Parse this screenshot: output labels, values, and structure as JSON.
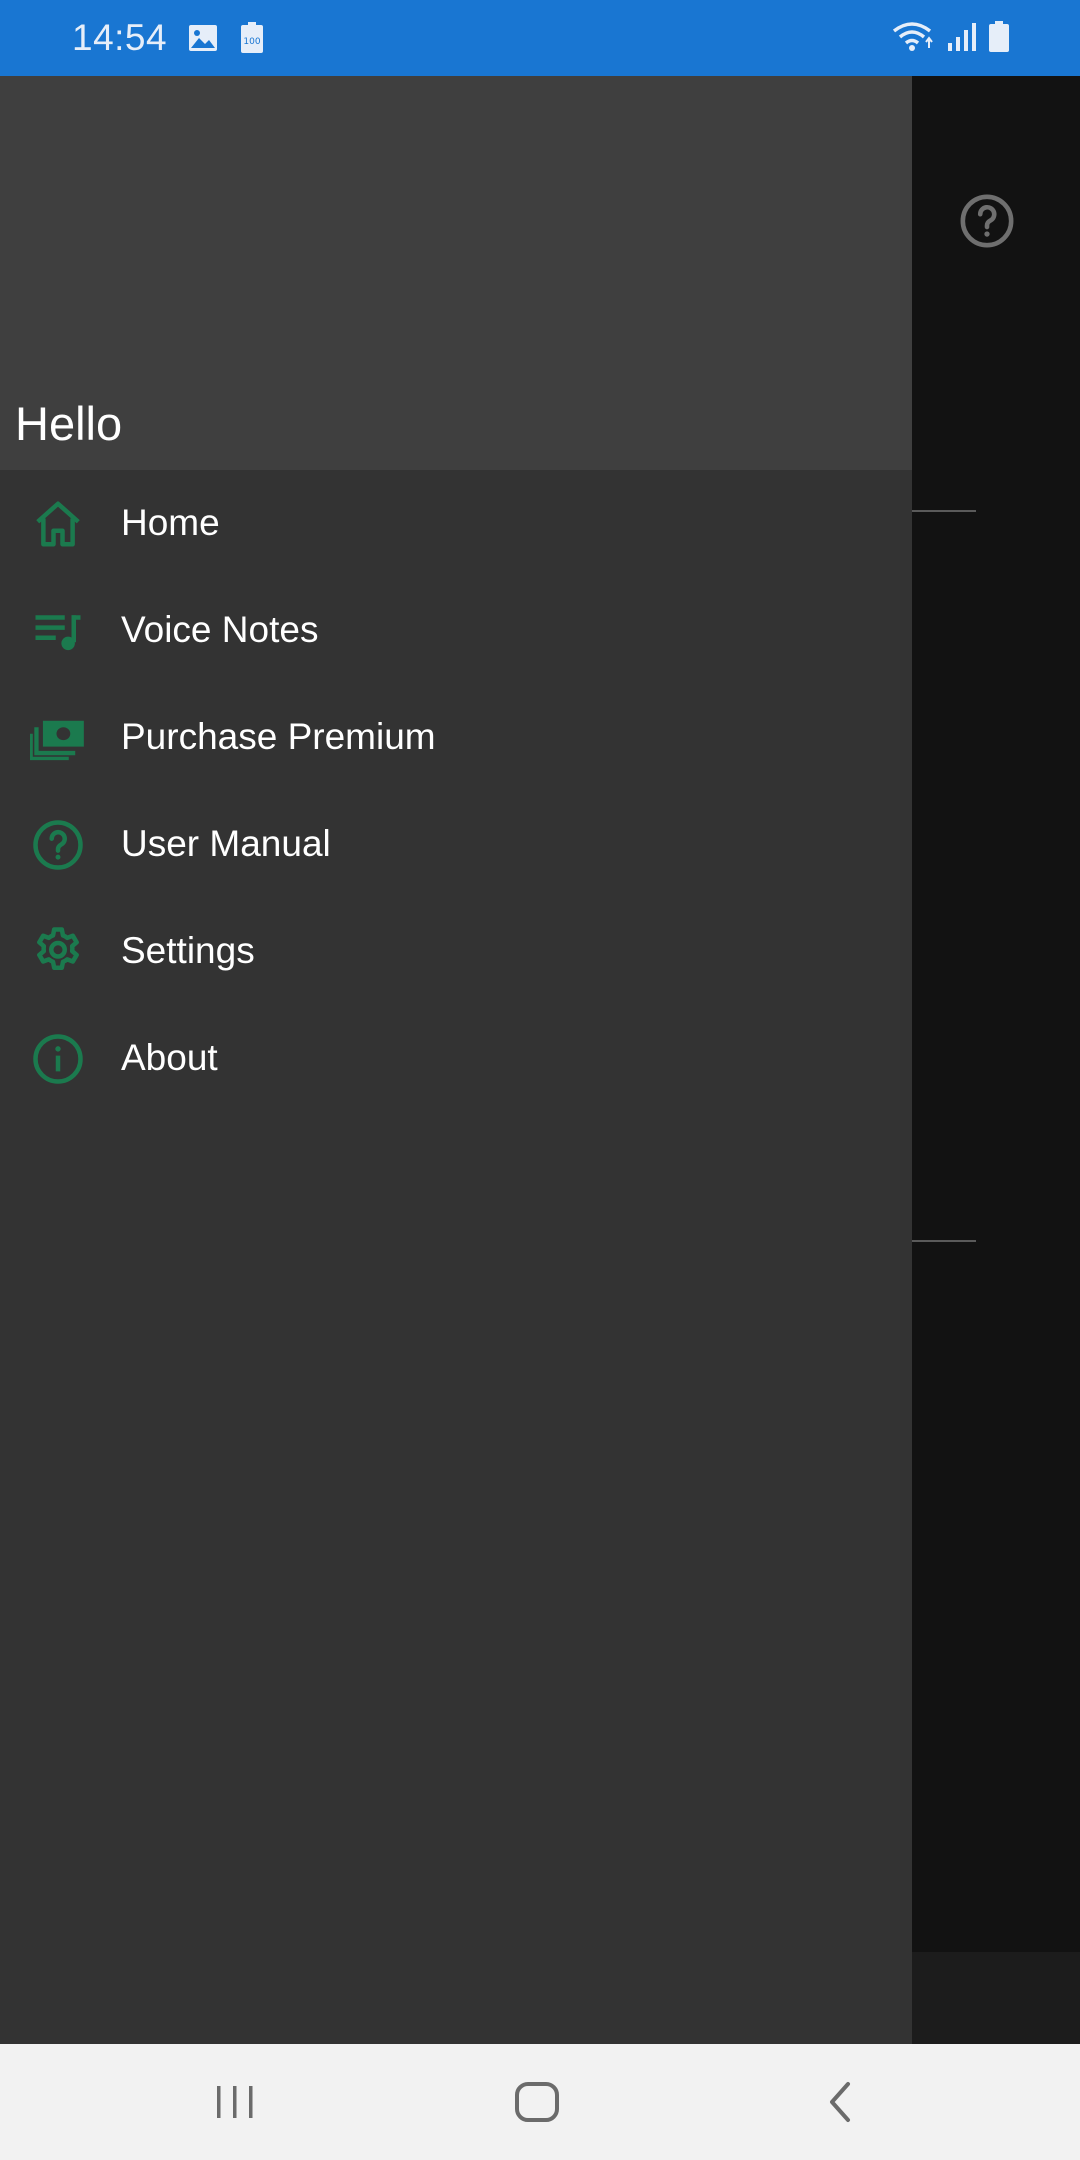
{
  "status_bar": {
    "time": "14:54",
    "left_icons": [
      "image-icon",
      "battery-saver-icon"
    ],
    "right_icons": [
      "wifi-icon",
      "signal-icon",
      "battery-icon"
    ],
    "background": "#1976D2"
  },
  "drawer": {
    "header_title": "Hello",
    "accent_color": "#1B7A4E",
    "items": [
      {
        "label": "Home",
        "icon": "home-icon"
      },
      {
        "label": "Voice Notes",
        "icon": "playlist-music-icon"
      },
      {
        "label": "Purchase Premium",
        "icon": "cash-multiple-icon"
      },
      {
        "label": "User Manual",
        "icon": "help-circle-icon"
      },
      {
        "label": "Settings",
        "icon": "gear-icon"
      },
      {
        "label": "About",
        "icon": "info-icon"
      }
    ]
  },
  "background_app": {
    "toolbar_icon": "help-circle-icon"
  },
  "nav_bar": {
    "buttons": [
      "recent-apps-icon",
      "home-button-icon",
      "back-icon"
    ]
  }
}
